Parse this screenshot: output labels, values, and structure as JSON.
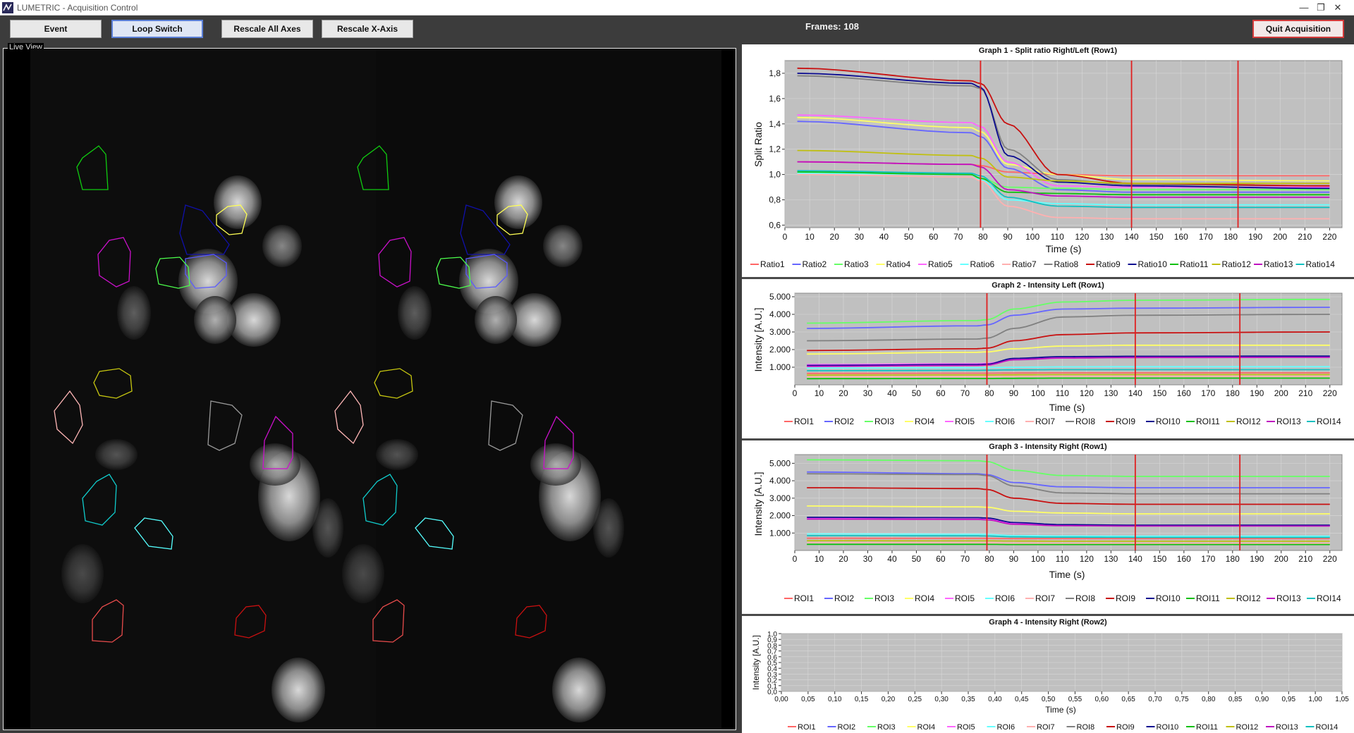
{
  "window": {
    "title": "LUMETRIC - Acquisition Control",
    "minimize_glyph": "—",
    "restore_glyph": "❐",
    "close_glyph": "✕"
  },
  "toolbar": {
    "event_label": "Event",
    "loop_label": "Loop Switch",
    "rescale_all_label": "Rescale All Axes",
    "rescale_x_label": "Rescale X-Axis",
    "frames_text": "Frames: 108",
    "quit_label": "Quit Acquisition"
  },
  "live_view": {
    "label": "Live View",
    "roi_colors": [
      "#e84b4b",
      "#5a5aff",
      "#4cff4c",
      "#ffff55",
      "#ff55ff",
      "#55ffff",
      "#ffb6b6",
      "#9a9a9a",
      "#cc1010",
      "#1010aa",
      "#10cc10",
      "#c8c810",
      "#cc10cc",
      "#10cccc"
    ]
  },
  "colors": {
    "plot_bg": "#c0c0c0",
    "event_line": "#e02020",
    "series": [
      "#ff6666",
      "#6666ff",
      "#66ff66",
      "#ffff66",
      "#ff66ff",
      "#66ffff",
      "#ffb0b0",
      "#808080",
      "#c81010",
      "#0a0a90",
      "#10c010",
      "#c0c010",
      "#c010c0",
      "#10c0c0"
    ]
  },
  "graphs": [
    {
      "title": "Graph 1 - Split ratio Right/Left (Row1)",
      "ylabel": "Split Ratio",
      "xlabel": "Time (s)",
      "legend": [
        "Ratio1",
        "Ratio2",
        "Ratio3",
        "Ratio4",
        "Ratio5",
        "Ratio6",
        "Ratio7",
        "Ratio8",
        "Ratio9",
        "Ratio10",
        "Ratio11",
        "Ratio12",
        "Ratio13",
        "Ratio14"
      ],
      "yticks": [
        "0,6",
        "0,8",
        "1,0",
        "1,2",
        "1,4",
        "1,6",
        "1,8"
      ],
      "xticks": [
        "0",
        "10",
        "20",
        "30",
        "40",
        "50",
        "60",
        "70",
        "80",
        "90",
        "100",
        "110",
        "120",
        "130",
        "140",
        "150",
        "160",
        "170",
        "180",
        "190",
        "200",
        "210",
        "220"
      ]
    },
    {
      "title": "Graph 2 - Intensity Left (Row1)",
      "ylabel": "Intensity [A.U.]",
      "xlabel": "Time (s)",
      "legend": [
        "ROI1",
        "ROI2",
        "ROI3",
        "ROI4",
        "ROI5",
        "ROI6",
        "ROI7",
        "ROI8",
        "ROI9",
        "ROI10",
        "ROI11",
        "ROI12",
        "ROI13",
        "ROI14"
      ],
      "yticks": [
        "1.000",
        "2.000",
        "3.000",
        "4.000",
        "5.000"
      ],
      "xticks": [
        "0",
        "10",
        "20",
        "30",
        "40",
        "50",
        "60",
        "70",
        "80",
        "90",
        "100",
        "110",
        "120",
        "130",
        "140",
        "150",
        "160",
        "170",
        "180",
        "190",
        "200",
        "210",
        "220"
      ]
    },
    {
      "title": "Graph 3 - Intensity Right (Row1)",
      "ylabel": "Intensity [A.U.]",
      "xlabel": "Time (s)",
      "legend": [
        "ROI1",
        "ROI2",
        "ROI3",
        "ROI4",
        "ROI5",
        "ROI6",
        "ROI7",
        "ROI8",
        "ROI9",
        "ROI10",
        "ROI11",
        "ROI12",
        "ROI13",
        "ROI14"
      ],
      "yticks": [
        "1.000",
        "2.000",
        "3.000",
        "4.000",
        "5.000"
      ],
      "xticks": [
        "0",
        "10",
        "20",
        "30",
        "40",
        "50",
        "60",
        "70",
        "80",
        "90",
        "100",
        "110",
        "120",
        "130",
        "140",
        "150",
        "160",
        "170",
        "180",
        "190",
        "200",
        "210",
        "220"
      ]
    },
    {
      "title": "Graph 4 - Intensity Right (Row2)",
      "ylabel": "Intensity [A.U.]",
      "xlabel": "Time (s)",
      "legend": [
        "ROI1",
        "ROI2",
        "ROI3",
        "ROI4",
        "ROI5",
        "ROI6",
        "ROI7",
        "ROI8",
        "ROI9",
        "ROI10",
        "ROI11",
        "ROI12",
        "ROI13",
        "ROI14"
      ],
      "yticks": [
        "0,0",
        "0,1",
        "0,2",
        "0,3",
        "0,4",
        "0,5",
        "0,6",
        "0,7",
        "0,8",
        "0,9",
        "1,0"
      ],
      "xticks": [
        "0,00",
        "0,05",
        "0,10",
        "0,15",
        "0,20",
        "0,25",
        "0,30",
        "0,35",
        "0,40",
        "0,45",
        "0,50",
        "0,55",
        "0,60",
        "0,65",
        "0,70",
        "0,75",
        "0,80",
        "0,85",
        "0,90",
        "0,95",
        "1,00",
        "1,05"
      ]
    }
  ],
  "chart_data": [
    {
      "type": "line",
      "title": "Graph 1 - Split ratio Right/Left (Row1)",
      "xlabel": "Time (s)",
      "ylabel": "Split Ratio",
      "xlim": [
        0,
        225
      ],
      "ylim": [
        0.58,
        1.9
      ],
      "event_lines_x": [
        79,
        140,
        183
      ],
      "x": [
        5,
        75,
        79,
        90,
        110,
        140,
        220
      ],
      "series": [
        {
          "name": "Ratio1",
          "values": [
            1.1,
            1.08,
            1.07,
            1.02,
            1.0,
            0.99,
            0.99
          ]
        },
        {
          "name": "Ratio2",
          "values": [
            1.42,
            1.33,
            1.3,
            1.05,
            0.88,
            0.86,
            0.86
          ]
        },
        {
          "name": "Ratio3",
          "values": [
            1.02,
            1.0,
            0.97,
            0.9,
            0.89,
            0.88,
            0.88
          ]
        },
        {
          "name": "Ratio4",
          "values": [
            1.45,
            1.37,
            1.34,
            1.08,
            1.0,
            0.96,
            0.95
          ]
        },
        {
          "name": "Ratio5",
          "values": [
            1.47,
            1.41,
            1.38,
            1.1,
            0.91,
            0.9,
            0.9
          ]
        },
        {
          "name": "Ratio6",
          "values": [
            1.01,
            1.0,
            0.96,
            0.8,
            0.77,
            0.76,
            0.76
          ]
        },
        {
          "name": "Ratio7",
          "values": [
            1.0,
            0.98,
            0.95,
            0.75,
            0.66,
            0.65,
            0.65
          ]
        },
        {
          "name": "Ratio8",
          "values": [
            1.78,
            1.7,
            1.68,
            1.2,
            0.96,
            0.92,
            0.91
          ]
        },
        {
          "name": "Ratio9",
          "values": [
            1.84,
            1.74,
            1.72,
            1.4,
            1.0,
            0.93,
            0.91
          ]
        },
        {
          "name": "Ratio10",
          "values": [
            1.8,
            1.72,
            1.69,
            1.15,
            0.94,
            0.91,
            0.89
          ]
        },
        {
          "name": "Ratio11",
          "values": [
            1.02,
            1.0,
            0.97,
            0.86,
            0.85,
            0.84,
            0.84
          ]
        },
        {
          "name": "Ratio12",
          "values": [
            1.19,
            1.15,
            1.13,
            0.98,
            0.95,
            0.93,
            0.93
          ]
        },
        {
          "name": "Ratio13",
          "values": [
            1.1,
            1.08,
            1.06,
            0.88,
            0.83,
            0.82,
            0.82
          ]
        },
        {
          "name": "Ratio14",
          "values": [
            1.03,
            1.01,
            0.99,
            0.82,
            0.75,
            0.74,
            0.74
          ]
        }
      ]
    },
    {
      "type": "line",
      "title": "Graph 2 - Intensity Left (Row1)",
      "xlabel": "Time (s)",
      "ylabel": "Intensity [A.U.]",
      "xlim": [
        0,
        225
      ],
      "ylim": [
        0,
        5200
      ],
      "event_lines_x": [
        79,
        140,
        183
      ],
      "x": [
        5,
        75,
        79,
        90,
        110,
        140,
        220
      ],
      "series": [
        {
          "name": "ROI1",
          "values": [
            650,
            660,
            660,
            670,
            680,
            680,
            680
          ]
        },
        {
          "name": "ROI2",
          "values": [
            3200,
            3350,
            3400,
            3950,
            4300,
            4350,
            4400
          ]
        },
        {
          "name": "ROI3",
          "values": [
            3500,
            3650,
            3700,
            4300,
            4700,
            4800,
            4850
          ]
        },
        {
          "name": "ROI4",
          "values": [
            1750,
            1850,
            1870,
            2050,
            2200,
            2250,
            2250
          ]
        },
        {
          "name": "ROI5",
          "values": [
            1150,
            1200,
            1220,
            1450,
            1550,
            1600,
            1620
          ]
        },
        {
          "name": "ROI6",
          "values": [
            950,
            970,
            980,
            1000,
            1020,
            1030,
            1030
          ]
        },
        {
          "name": "ROI7",
          "values": [
            450,
            460,
            460,
            470,
            480,
            480,
            480
          ]
        },
        {
          "name": "ROI8",
          "values": [
            2500,
            2600,
            2650,
            3200,
            3850,
            3950,
            4000
          ]
        },
        {
          "name": "ROI9",
          "values": [
            1950,
            2050,
            2080,
            2500,
            2850,
            2950,
            3000
          ]
        },
        {
          "name": "ROI10",
          "values": [
            1100,
            1150,
            1170,
            1500,
            1600,
            1620,
            1630
          ]
        },
        {
          "name": "ROI11",
          "values": [
            350,
            360,
            360,
            370,
            380,
            380,
            380
          ]
        },
        {
          "name": "ROI12",
          "values": [
            550,
            560,
            560,
            570,
            580,
            580,
            580
          ]
        },
        {
          "name": "ROI13",
          "values": [
            1050,
            1100,
            1120,
            1420,
            1520,
            1550,
            1560
          ]
        },
        {
          "name": "ROI14",
          "values": [
            800,
            820,
            830,
            850,
            860,
            860,
            860
          ]
        }
      ]
    },
    {
      "type": "line",
      "title": "Graph 3 - Intensity Right (Row1)",
      "xlabel": "Time (s)",
      "ylabel": "Intensity [A.U.]",
      "xlim": [
        0,
        225
      ],
      "ylim": [
        0,
        5500
      ],
      "event_lines_x": [
        79,
        140,
        183
      ],
      "x": [
        5,
        75,
        79,
        90,
        110,
        140,
        220
      ],
      "series": [
        {
          "name": "ROI1",
          "values": [
            700,
            690,
            690,
            680,
            680,
            680,
            680
          ]
        },
        {
          "name": "ROI2",
          "values": [
            4500,
            4400,
            4350,
            3900,
            3650,
            3600,
            3600
          ]
        },
        {
          "name": "ROI3",
          "values": [
            5200,
            5150,
            5100,
            4600,
            4300,
            4250,
            4250
          ]
        },
        {
          "name": "ROI4",
          "values": [
            2550,
            2500,
            2480,
            2250,
            2150,
            2100,
            2100
          ]
        },
        {
          "name": "ROI5",
          "values": [
            1850,
            1800,
            1790,
            1550,
            1450,
            1420,
            1420
          ]
        },
        {
          "name": "ROI6",
          "values": [
            950,
            930,
            920,
            850,
            830,
            820,
            820
          ]
        },
        {
          "name": "ROI7",
          "values": [
            450,
            440,
            440,
            420,
            410,
            410,
            410
          ]
        },
        {
          "name": "ROI8",
          "values": [
            4400,
            4350,
            4300,
            3700,
            3300,
            3250,
            3250
          ]
        },
        {
          "name": "ROI9",
          "values": [
            3600,
            3550,
            3500,
            3000,
            2700,
            2650,
            2650
          ]
        },
        {
          "name": "ROI10",
          "values": [
            1900,
            1880,
            1860,
            1600,
            1480,
            1450,
            1450
          ]
        },
        {
          "name": "ROI11",
          "values": [
            350,
            350,
            350,
            340,
            340,
            340,
            340
          ]
        },
        {
          "name": "ROI12",
          "values": [
            560,
            550,
            550,
            540,
            530,
            530,
            530
          ]
        },
        {
          "name": "ROI13",
          "values": [
            1800,
            1780,
            1760,
            1500,
            1420,
            1400,
            1400
          ]
        },
        {
          "name": "ROI14",
          "values": [
            850,
            840,
            830,
            780,
            760,
            750,
            750
          ]
        }
      ]
    },
    {
      "type": "line",
      "title": "Graph 4 - Intensity Right (Row2)",
      "xlabel": "Time (s)",
      "ylabel": "Intensity [A.U.]",
      "xlim": [
        0.0,
        1.05
      ],
      "ylim": [
        0.0,
        1.0
      ],
      "series": []
    }
  ]
}
